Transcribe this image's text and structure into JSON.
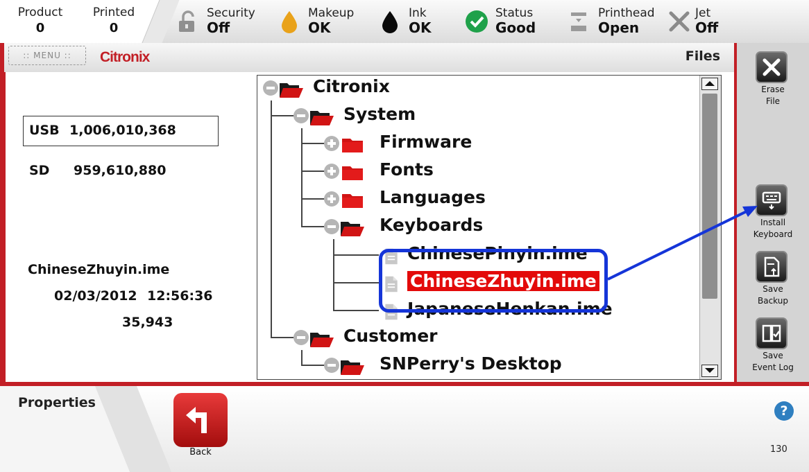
{
  "status_bar": {
    "product": {
      "label": "Product",
      "value": "0"
    },
    "printed": {
      "label": "Printed",
      "value": "0"
    },
    "security": {
      "label": "Security",
      "value": "Off"
    },
    "makeup": {
      "label": "Makeup",
      "value": "OK"
    },
    "ink": {
      "label": "Ink",
      "value": "OK"
    },
    "status": {
      "label": "Status",
      "value": "Good"
    },
    "printhead": {
      "label": "Printhead",
      "value": "Open"
    },
    "jet": {
      "label": "Jet",
      "value": "Off"
    }
  },
  "header": {
    "menu_label": ":: MENU ::",
    "logo_text": "Citronix",
    "title": "Files"
  },
  "storage": {
    "usb_label": "USB",
    "usb_value": "1,006,010,368",
    "sd_label": "SD",
    "sd_value": "959,610,880"
  },
  "selected_file": {
    "name": "ChineseZhuyin.ime",
    "date": "02/03/2012",
    "time": "12:56:36",
    "size": "35,943"
  },
  "tree": {
    "citronix": "Citronix",
    "system": "System",
    "firmware": "Firmware",
    "fonts": "Fonts",
    "languages": "Languages",
    "keyboards": "Keyboards",
    "file1": "ChinesePinyin.ime",
    "file2": "ChineseZhuyin.ime",
    "file3": "JapaneseHenkan.ime",
    "customer": "Customer",
    "desktop": "SNPerry's Desktop"
  },
  "sidebar": {
    "erase": {
      "line1": "Erase",
      "line2": "File"
    },
    "install": {
      "line1": "Install",
      "line2": "Keyboard"
    },
    "save_backup": {
      "line1": "Save",
      "line2": "Backup"
    },
    "save_log": {
      "line1": "Save",
      "line2": "Event Log"
    }
  },
  "bottom": {
    "properties_label": "Properties",
    "back_label": "Back",
    "help_glyph": "?",
    "page_number": "130"
  },
  "colors": {
    "brand_red": "#c21f26",
    "selection_red": "#e30a0a",
    "annotation_blue": "#1535d8",
    "status_green": "#1fa14a",
    "makeup_yellow": "#e9a21a"
  },
  "icons": {
    "security": "unlocked-padlock-icon",
    "makeup": "yellow-drop-icon",
    "ink": "black-drop-icon",
    "status": "green-check-icon",
    "printhead": "printhead-icon",
    "jet": "x-icon",
    "erase": "close-icon",
    "install": "keyboard-install-icon",
    "save_backup": "document-upload-icon",
    "save_log": "book-check-icon",
    "back": "turn-left-arrow-icon",
    "help": "help-icon"
  }
}
